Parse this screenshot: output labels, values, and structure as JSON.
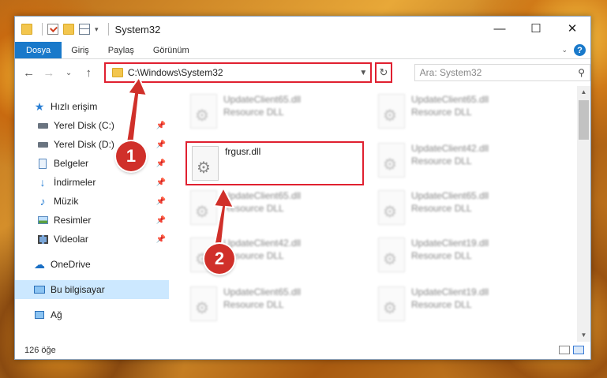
{
  "window": {
    "title": "System32",
    "controls": {
      "minimize": "—",
      "maximize": "☐",
      "close": "✕"
    }
  },
  "ribbon": {
    "tabs": [
      "Dosya",
      "Giriş",
      "Paylaş",
      "Görünüm"
    ],
    "help": "?"
  },
  "nav": {
    "back": "←",
    "forward": "→",
    "recent": "⌄",
    "up": "↑",
    "address": "C:\\Windows\\System32",
    "refresh": "↻",
    "search_placeholder": "Ara: System32"
  },
  "sidebar": {
    "quick_access": "Hızlı erişim",
    "items": [
      {
        "label": "Yerel Disk (C:)",
        "icon": "drive-icon"
      },
      {
        "label": "Yerel Disk (D:)",
        "icon": "drive-icon"
      },
      {
        "label": "Belgeler",
        "icon": "documents-icon"
      },
      {
        "label": "İndirmeler",
        "icon": "download-icon"
      },
      {
        "label": "Müzik",
        "icon": "music-icon"
      },
      {
        "label": "Resimler",
        "icon": "pictures-icon"
      },
      {
        "label": "Videolar",
        "icon": "videos-icon"
      }
    ],
    "onedrive": "OneDrive",
    "this_pc": "Bu bilgisayar",
    "network": "Ağ"
  },
  "files": [
    {
      "name": "UpdateClient65.dll",
      "type": "Resource DLL",
      "blurred": true
    },
    {
      "name": "UpdateClient65.dll",
      "type": "Resource DLL",
      "blurred": true
    },
    {
      "name": "frgusr.dll",
      "type": "",
      "blurred": false
    },
    {
      "name": "UpdateClient42.dll",
      "type": "Resource DLL",
      "blurred": true
    },
    {
      "name": "UpdateClient65.dll",
      "type": "Resource DLL",
      "blurred": true
    },
    {
      "name": "UpdateClient65.dll",
      "type": "Resource DLL",
      "blurred": true
    },
    {
      "name": "UpdateClient42.dll",
      "type": "Resource DLL",
      "blurred": true
    },
    {
      "name": "UpdateClient19.dll",
      "type": "Resource DLL",
      "blurred": true
    },
    {
      "name": "UpdateClient65.dll",
      "type": "Resource DLL",
      "blurred": true
    },
    {
      "name": "UpdateClient19.dll",
      "type": "Resource DLL",
      "blurred": true
    }
  ],
  "status": {
    "count": "126 öğe"
  },
  "annotations": {
    "badge1": "1",
    "badge2": "2",
    "color": "#d0302a"
  }
}
